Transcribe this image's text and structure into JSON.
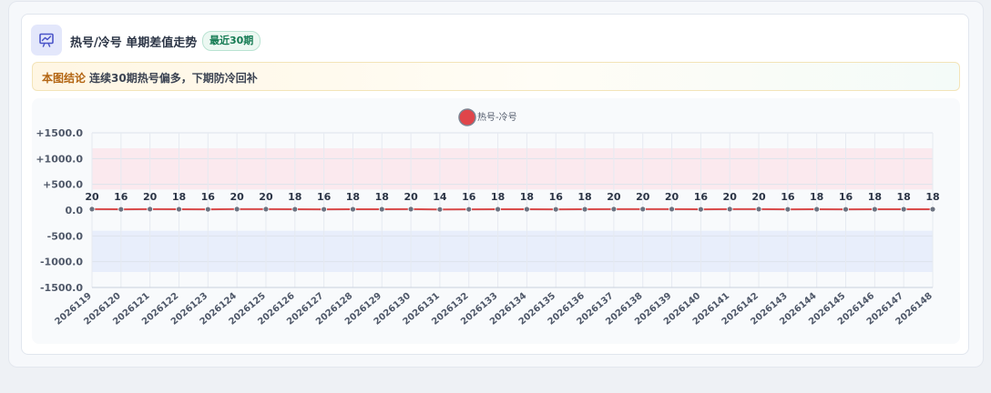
{
  "header": {
    "title": "热号/冷号 单期差值走势",
    "badge": "最近30期",
    "icon": "chart-icon"
  },
  "conclusion": {
    "label": "本图结论",
    "text": "连续30期热号偏多，下期防冷回补"
  },
  "colors": {
    "series_line": "#d94b4b",
    "point": "#6b7280",
    "hot_band": "#fbe9ee",
    "cold_band": "#e8eefb",
    "legend_marker": "#e0454a"
  },
  "chart_data": {
    "type": "line",
    "title": "",
    "xlabel": "",
    "ylabel": "",
    "ylim": [
      -1500,
      1500
    ],
    "yticks": [
      "+1500.0",
      "+1000.0",
      "+500.0",
      "0.0",
      "-500.0",
      "-1000.0",
      "-1500.0"
    ],
    "ytick_values": [
      1500,
      1000,
      500,
      0,
      -500,
      -1000,
      -1500
    ],
    "bands": [
      {
        "from": 400,
        "to": 1200,
        "color": "#fbe9ee"
      },
      {
        "from": -1200,
        "to": -400,
        "color": "#e8eefb"
      }
    ],
    "legend": {
      "position": "top-center"
    },
    "grid": true,
    "categories": [
      "2026119",
      "2026120",
      "2026121",
      "2026122",
      "2026123",
      "2026124",
      "2026125",
      "2026126",
      "2026127",
      "2026128",
      "2026129",
      "2026130",
      "2026131",
      "2026132",
      "2026133",
      "2026134",
      "2026135",
      "2026136",
      "2026137",
      "2026138",
      "2026139",
      "2026140",
      "2026141",
      "2026142",
      "2026143",
      "2026144",
      "2026145",
      "2026146",
      "2026147",
      "2026148"
    ],
    "series": [
      {
        "name": "热号-冷号",
        "values": [
          20,
          16,
          20,
          18,
          16,
          20,
          20,
          18,
          16,
          18,
          18,
          20,
          14,
          16,
          18,
          18,
          16,
          18,
          20,
          20,
          20,
          16,
          20,
          20,
          16,
          18,
          16,
          18,
          18,
          18
        ]
      }
    ]
  }
}
